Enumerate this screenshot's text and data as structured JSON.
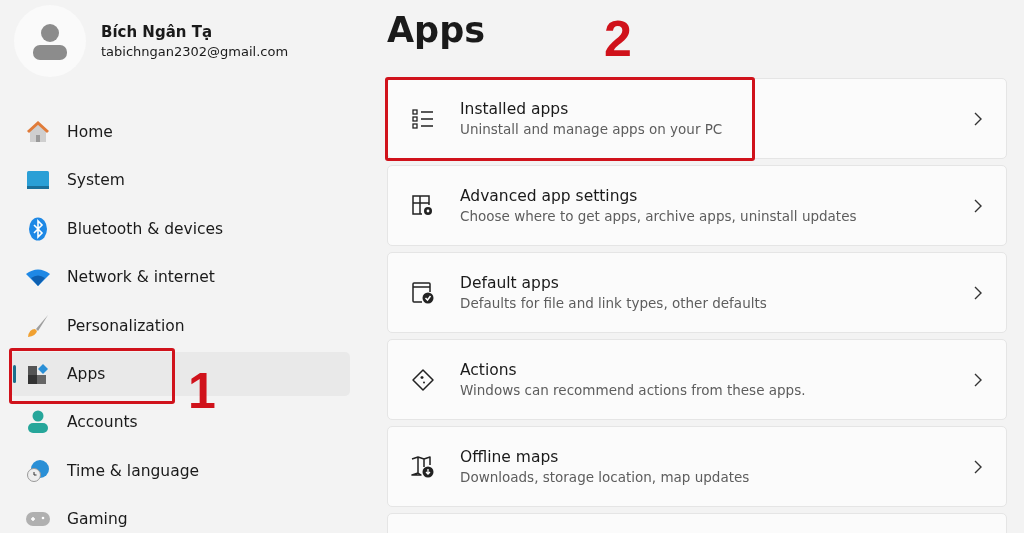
{
  "profile": {
    "name": "Bích Ngân Tạ",
    "email": "tabichngan2302@gmail.com"
  },
  "sidebar": {
    "items": [
      {
        "label": "Home",
        "selected": false
      },
      {
        "label": "System",
        "selected": false
      },
      {
        "label": "Bluetooth & devices",
        "selected": false
      },
      {
        "label": "Network & internet",
        "selected": false
      },
      {
        "label": "Personalization",
        "selected": false
      },
      {
        "label": "Apps",
        "selected": true,
        "annotation": "1"
      },
      {
        "label": "Accounts",
        "selected": false
      },
      {
        "label": "Time & language",
        "selected": false
      },
      {
        "label": "Gaming",
        "selected": false
      }
    ]
  },
  "page": {
    "title": "Apps",
    "annotation": "2"
  },
  "cards": [
    {
      "title": "Installed apps",
      "description": "Uninstall and manage apps on your PC",
      "highlighted": true
    },
    {
      "title": "Advanced app settings",
      "description": "Choose where to get apps, archive apps, uninstall updates",
      "highlighted": false
    },
    {
      "title": "Default apps",
      "description": "Defaults for file and link types, other defaults",
      "highlighted": false
    },
    {
      "title": "Actions",
      "description": "Windows can recommend actions from these apps.",
      "highlighted": false
    },
    {
      "title": "Offline maps",
      "description": "Downloads, storage location, map updates",
      "highlighted": false
    }
  ]
}
